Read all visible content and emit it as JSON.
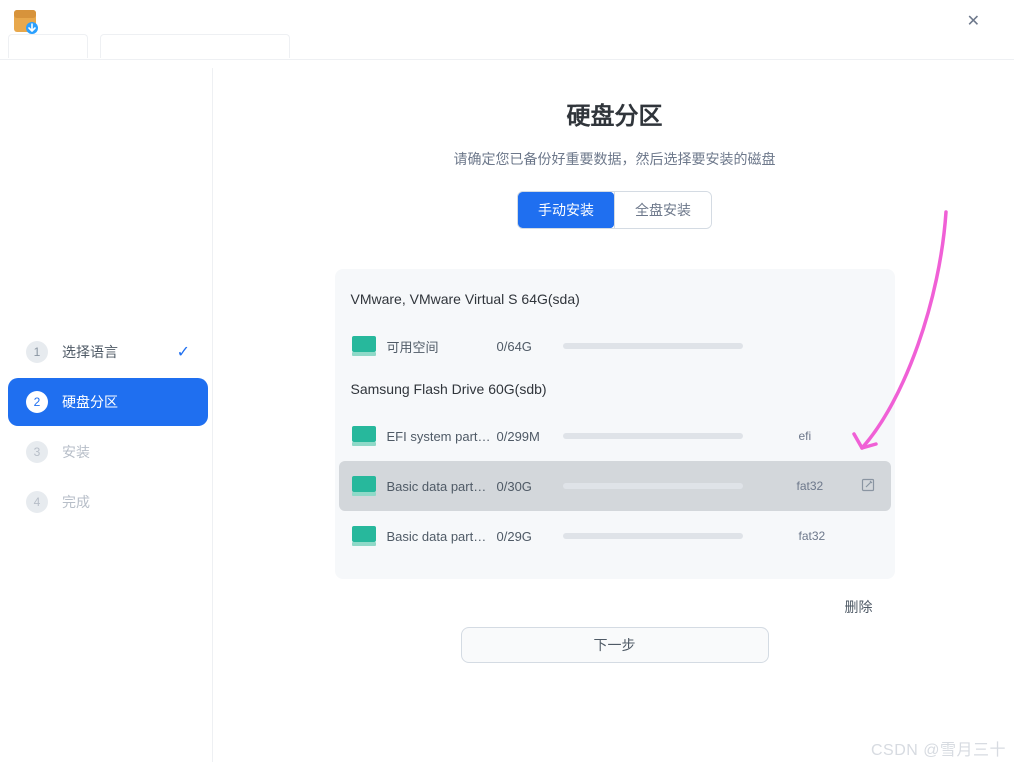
{
  "titlebar": {
    "close": "✕"
  },
  "sidebar": {
    "steps": [
      {
        "num": "1",
        "label": "选择语言",
        "check": "✓"
      },
      {
        "num": "2",
        "label": "硬盘分区"
      },
      {
        "num": "3",
        "label": "安装"
      },
      {
        "num": "4",
        "label": "完成"
      }
    ]
  },
  "main": {
    "title": "硬盘分区",
    "subtitle": "请确定您已备份好重要数据，然后选择要安装的磁盘",
    "modes": {
      "manual": "手动安装",
      "full": "全盘安装"
    },
    "disks": [
      {
        "header": "VMware, VMware Virtual S 64G(sda)",
        "partitions": [
          {
            "name": "可用空间",
            "size": "0/64G",
            "fs": "",
            "selected": false,
            "edit": false
          }
        ]
      },
      {
        "header": "Samsung Flash Drive 60G(sdb)",
        "partitions": [
          {
            "name": "EFI system part…",
            "size": "0/299M",
            "fs": "efi",
            "selected": false,
            "edit": false
          },
          {
            "name": "Basic data part…",
            "size": "0/30G",
            "fs": "fat32",
            "selected": true,
            "edit": true
          },
          {
            "name": "Basic data part…",
            "size": "0/29G",
            "fs": "fat32",
            "selected": false,
            "edit": false
          }
        ]
      }
    ],
    "delete_label": "删除",
    "next_label": "下一步"
  },
  "watermark": "CSDN @雪月三十",
  "icon_names": {
    "app": "installer-app-icon",
    "close": "close-icon",
    "check": "check-icon",
    "disk": "disk-icon",
    "edit": "edit-icon"
  }
}
